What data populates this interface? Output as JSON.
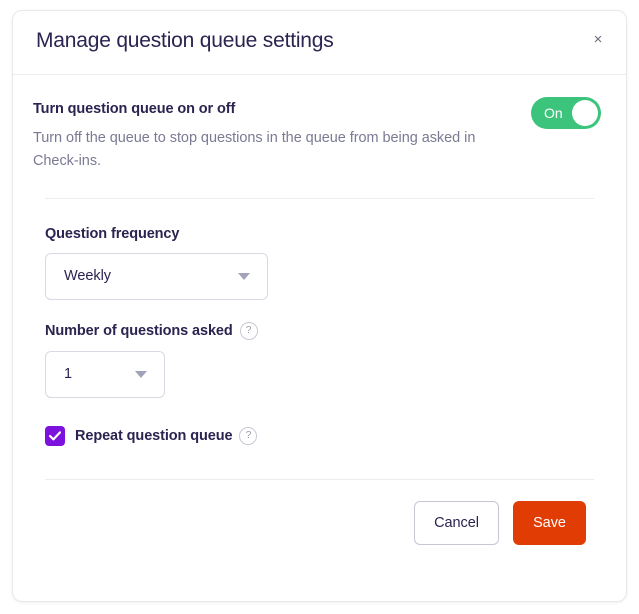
{
  "modal": {
    "title": "Manage question queue settings",
    "close_icon": "close-icon",
    "close_label": "×"
  },
  "toggle_section": {
    "heading": "Turn question queue on or off",
    "description": "Turn off the queue to stop questions in the queue from being asked in Check-ins.",
    "toggle": {
      "state_label": "On",
      "checked": true,
      "on_color": "#3cc47c"
    }
  },
  "fields": {
    "frequency": {
      "label": "Question frequency",
      "value": "Weekly",
      "options": [
        "Weekly"
      ],
      "arrow_icon": "chevron-down-icon"
    },
    "number_of_questions": {
      "label": "Number of questions asked",
      "value": "1",
      "options": [
        "1"
      ],
      "help_icon": "help-circle-icon",
      "help_glyph": "?",
      "arrow_icon": "chevron-down-icon"
    },
    "repeat_queue": {
      "label": "Repeat question queue",
      "checked": true,
      "check_color": "#7d11dd",
      "help_icon": "help-circle-icon",
      "help_glyph": "?"
    }
  },
  "footer": {
    "cancel_label": "Cancel",
    "save_label": "Save",
    "save_color": "#e13c04"
  }
}
